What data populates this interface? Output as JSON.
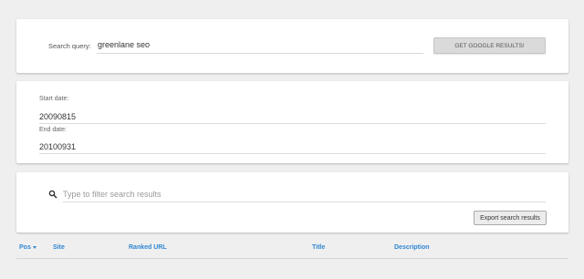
{
  "search": {
    "label": "Search query:",
    "value": "greenlane seo",
    "button_label": "GET GOOGLE RESULTS!"
  },
  "dates": {
    "start_label": "Start date:",
    "start_value": "20090815",
    "end_label": "End date:",
    "end_value": "20100931"
  },
  "filter": {
    "placeholder": "Type to filter search results",
    "icon": "search-icon",
    "export_label": "Export search results"
  },
  "table": {
    "columns": [
      {
        "label": "Pos",
        "sorted": "desc"
      },
      {
        "label": "Site"
      },
      {
        "label": "Ranked URL"
      },
      {
        "label": "Title"
      },
      {
        "label": "Description"
      }
    ]
  },
  "colors": {
    "background": "#efefef",
    "link": "#2f86d2",
    "button": "#dadada"
  }
}
